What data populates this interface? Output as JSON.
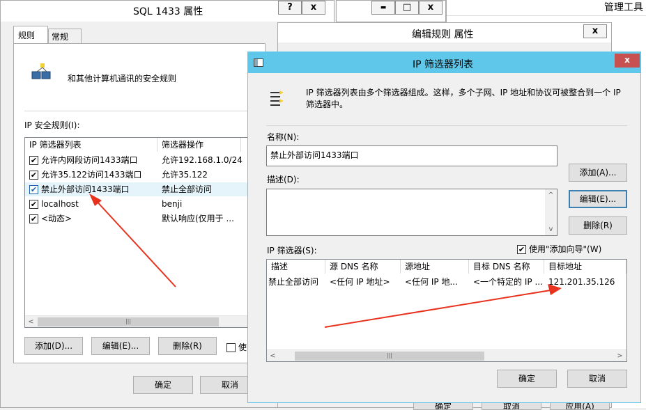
{
  "bg_dialog": {
    "title": "SQL 1433 属性",
    "help_btn": "?",
    "close_btn": "x",
    "tabs": [
      "规则",
      "常规"
    ],
    "desc": "和其他计算机通讯的安全规则",
    "rules_label": "IP 安全规则(I):",
    "columns": [
      "IP 筛选器列表",
      "筛选器操作"
    ],
    "rows": [
      {
        "checked": "✔",
        "filter": "允许内网段访问1433端口",
        "action": "允许192.168.1.0/24"
      },
      {
        "checked": "✔",
        "filter": "允许35.122访问1433端口",
        "action": "允许35.122"
      },
      {
        "checked": "✔",
        "filter": "禁止外部访问1433端口",
        "action": "禁止全部访问"
      },
      {
        "checked": "✔",
        "filter": "localhost",
        "action": "benji"
      },
      {
        "checked": "✔",
        "filter": "<动态>",
        "action": "默认响应(仅用于 ..."
      }
    ],
    "add": "添加(D)...",
    "edit": "编辑(E)...",
    "remove": "删除(R)",
    "use_partial": "使",
    "ok": "确定",
    "cancel": "取消"
  },
  "mid_window": {
    "min": "▬",
    "max": "□",
    "close": "x"
  },
  "right_window": {
    "title": "管理工具"
  },
  "edit_rule": {
    "title": "编辑规则 属性",
    "close": "x",
    "bottom_ok": "确定",
    "bottom_cancel": "取消",
    "bottom_apply": "应用(A)"
  },
  "ip_filter_list": {
    "title": "IP 筛选器列表",
    "close": "x",
    "desc": "IP 筛选器列表由多个筛选器组成。这样，多个子网、IP 地址和协议可被整合到一个 IP 筛选器中。",
    "name_label": "名称(N):",
    "name_value": "禁止外部访问1433端口",
    "desc_label": "描述(D):",
    "desc_value": "",
    "add": "添加(A)...",
    "edit": "编辑(E)...",
    "remove": "删除(R)",
    "filters_label": "IP 筛选器(S):",
    "use_wizard": "使用\"添加向导\"(W)",
    "wizard_checked": "✔",
    "columns": [
      "描述",
      "源 DNS 名称",
      "源地址",
      "目标 DNS 名称",
      "目标地址"
    ],
    "row": [
      "禁止全部访问",
      "<任何 IP 地址>",
      "<任何 IP 地...",
      "<一个特定的 IP ...",
      "121.201.35.126"
    ],
    "ok": "确定",
    "cancel": "取消"
  },
  "accent": "#5fc8ea",
  "close_red": "#c75050",
  "arrow_color": "#e8321e"
}
